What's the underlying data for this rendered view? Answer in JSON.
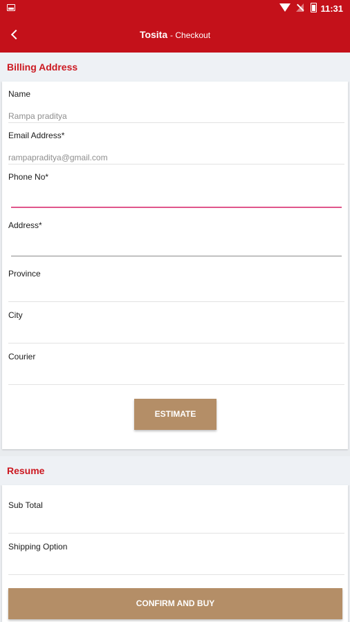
{
  "status_bar": {
    "time": "11:31",
    "icons": [
      "screen-icon",
      "wifi-icon",
      "signal-icon",
      "battery-icon"
    ]
  },
  "app_bar": {
    "brand": "Tosita",
    "subtitle": "- Checkout"
  },
  "billing": {
    "header": "Billing Address",
    "name_label": "Name",
    "name_value": "Rampa praditya",
    "email_label": "Email Address*",
    "email_value": "rampapraditya@gmail.com",
    "phone_label": "Phone No*",
    "address_label": "Address*",
    "province_label": "Province",
    "city_label": "City",
    "courier_label": "Courier",
    "estimate_label": "ESTIMATE"
  },
  "resume": {
    "header": "Resume",
    "subtotal_label": "Sub Total",
    "shipping_label": "Shipping Option",
    "confirm_label": "CONFIRM AND BUY"
  },
  "colors": {
    "primary": "#c4111a",
    "accent": "#b48e67",
    "focus": "#e0558b"
  }
}
